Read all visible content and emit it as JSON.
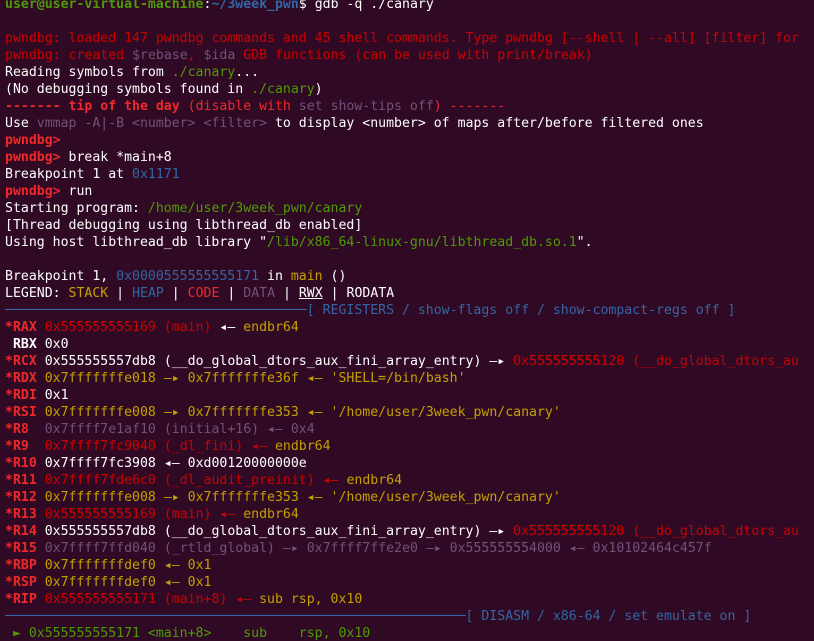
{
  "prompt": {
    "user": "user@user-virtual-machine",
    "path": "~/3week_pwn",
    "sym": "$",
    "cmd": " gdb -q ./canary"
  },
  "lines_top": [
    {
      "a": "pwndbg: ",
      "b": "loaded 147 pwndbg commands and 45 shell commands. Type ",
      "c": "pwndbg",
      "d": " [--shell | --all] [filter] for"
    },
    {
      "a": "pwndbg: ",
      "b": "created ",
      "c": "$rebase",
      "d": ", ",
      "e": "$ida",
      "f": " GDB functions (can be used with print/break)"
    }
  ],
  "reading": {
    "a": "Reading symbols from ",
    "b": "./canary",
    "c": "..."
  },
  "nodebug": {
    "a": "(No debugging symbols found in ",
    "b": "./canary",
    "c": ")"
  },
  "tip": {
    "a": "------- tip of the day ",
    "b": "(disable with ",
    "c": "set show-tips off",
    "d": ") -------"
  },
  "usevm": {
    "a": "Use ",
    "b": "vmmap -A|-B <number> <filter>",
    "c": " to display <number> of maps after/before filtered ones"
  },
  "pwnprompt": "pwndbg>",
  "break_cmd": " break *main+8",
  "bp1": {
    "a": "Breakpoint 1 at ",
    "b": "0x1171"
  },
  "run_cmd": " run",
  "starting": {
    "a": "Starting program: ",
    "b": "/home/user/3week_pwn/canary"
  },
  "thread": "[Thread debugging using libthread_db enabled]",
  "host": {
    "a": "Using host libthread_db library \"",
    "b": "/lib/x86_64-linux-gnu/libthread_db.so.1",
    "c": "\"."
  },
  "bphit": {
    "a": "Breakpoint 1, ",
    "b": "0x0000555555555171",
    "c": " in ",
    "d": "main",
    "e": " ()"
  },
  "legend": {
    "label": "LEGEND: ",
    "stack": "STACK",
    "heap": "HEAP",
    "code": "CODE",
    "data": "DATA",
    "rwx": "RWX",
    "rodata": "RODATA",
    "sep": " | "
  },
  "reg_header": "──────────────────────────────────────[ REGISTERS / show-flags off / show-compact-regs off ]",
  "registers": [
    {
      "star": "*",
      "name": "RAX",
      "v": " 0x555555555169 ",
      "s": "(main)",
      "arrow": " ◂— ",
      "t": "endbr64",
      "cls": "code",
      "tc": "yel"
    },
    {
      "star": " ",
      "name": "RBX",
      "v": " 0x0",
      "s": "",
      "arrow": "",
      "t": "",
      "cls": "plain",
      "tc": ""
    },
    {
      "star": "*",
      "name": "RCX",
      "v": " 0x555555557db8 (__do_global_dtors_aux_fini_array_entry) —▸ ",
      "s": "0x555555555120 (__do_global_dtors_au",
      "arrow": "",
      "t": "",
      "cls": "rcx",
      "tc": ""
    },
    {
      "star": "*",
      "name": "RDX",
      "v": " 0x7fffffffe018 —▸ 0x7fffffffe36f ◂— 'SHELL=/bin/bash'",
      "s": "",
      "arrow": "",
      "t": "",
      "cls": "stack",
      "tc": ""
    },
    {
      "star": "*",
      "name": "RDI",
      "v": " 0x1",
      "s": "",
      "arrow": "",
      "t": "",
      "cls": "plain",
      "tc": ""
    },
    {
      "star": "*",
      "name": "RSI",
      "v": " 0x7fffffffe008 —▸ 0x7fffffffe353 ◂— '/home/user/3week_pwn/canary'",
      "s": "",
      "arrow": "",
      "t": "",
      "cls": "stack",
      "tc": ""
    },
    {
      "star": "*",
      "name": "R8 ",
      "v": " 0x7ffff7e1af10 (initial+16) ◂— 0x4",
      "s": "",
      "arrow": "",
      "t": "",
      "cls": "data",
      "tc": ""
    },
    {
      "star": "*",
      "name": "R9 ",
      "v": " 0x7ffff7fc9040 (_dl_fini) ◂— ",
      "s": "",
      "arrow": "",
      "t": "endbr64",
      "cls": "codefn",
      "tc": "yel"
    },
    {
      "star": "*",
      "name": "R10",
      "v": " 0x7ffff7fc3908 ◂— 0xd00120000000e",
      "s": "",
      "arrow": "",
      "t": "",
      "cls": "plain",
      "tc": ""
    },
    {
      "star": "*",
      "name": "R11",
      "v": " 0x7ffff7fde6c0 (_dl_audit_preinit) ◂— ",
      "s": "",
      "arrow": "",
      "t": "endbr64",
      "cls": "codefn",
      "tc": "yel"
    },
    {
      "star": "*",
      "name": "R12",
      "v": " 0x7fffffffe008 —▸ 0x7fffffffe353 ◂— '/home/user/3week_pwn/canary'",
      "s": "",
      "arrow": "",
      "t": "",
      "cls": "stack",
      "tc": ""
    },
    {
      "star": "*",
      "name": "R13",
      "v": " 0x555555555169 (main) ◂— ",
      "s": "",
      "arrow": "",
      "t": "endbr64",
      "cls": "codefn",
      "tc": "yel"
    },
    {
      "star": "*",
      "name": "R14",
      "v": " 0x555555557db8 (__do_global_dtors_aux_fini_array_entry) —▸ ",
      "s": "0x555555555120 (__do_global_dtors_au",
      "arrow": "",
      "t": "",
      "cls": "rcx",
      "tc": ""
    },
    {
      "star": "*",
      "name": "R15",
      "v": " 0x7ffff7ffd040 (_rtld_global) —▸ 0x7ffff7ffe2e0 —▸ 0x555555554000 ◂— 0x10102464c457f",
      "s": "",
      "arrow": "",
      "t": "",
      "cls": "r15",
      "tc": ""
    },
    {
      "star": "*",
      "name": "RBP",
      "v": " 0x7fffffffdef0 ◂— 0x1",
      "s": "",
      "arrow": "",
      "t": "",
      "cls": "stack",
      "tc": ""
    },
    {
      "star": "*",
      "name": "RSP",
      "v": " 0x7fffffffdef0 ◂— 0x1",
      "s": "",
      "arrow": "",
      "t": "",
      "cls": "stack",
      "tc": ""
    },
    {
      "star": "*",
      "name": "RIP",
      "v": " 0x555555555171 (main+8) ◂— ",
      "s": "",
      "arrow": "",
      "t": "sub rsp, 0x10",
      "cls": "rip",
      "tc": "yel"
    }
  ],
  "disasm_header": "──────────────────────────────────────────────────────────[ DISASM / x86-64 / set emulate on ]",
  "disasm_line": " ► 0x555555555171 <main+8>    sub    rsp, 0x10",
  "colors": {
    "bg": "#300a24",
    "green": "#4e9a06",
    "blue": "#3465a4",
    "red": "#ef2929",
    "yellow": "#c4a000",
    "purple": "#75507b"
  }
}
